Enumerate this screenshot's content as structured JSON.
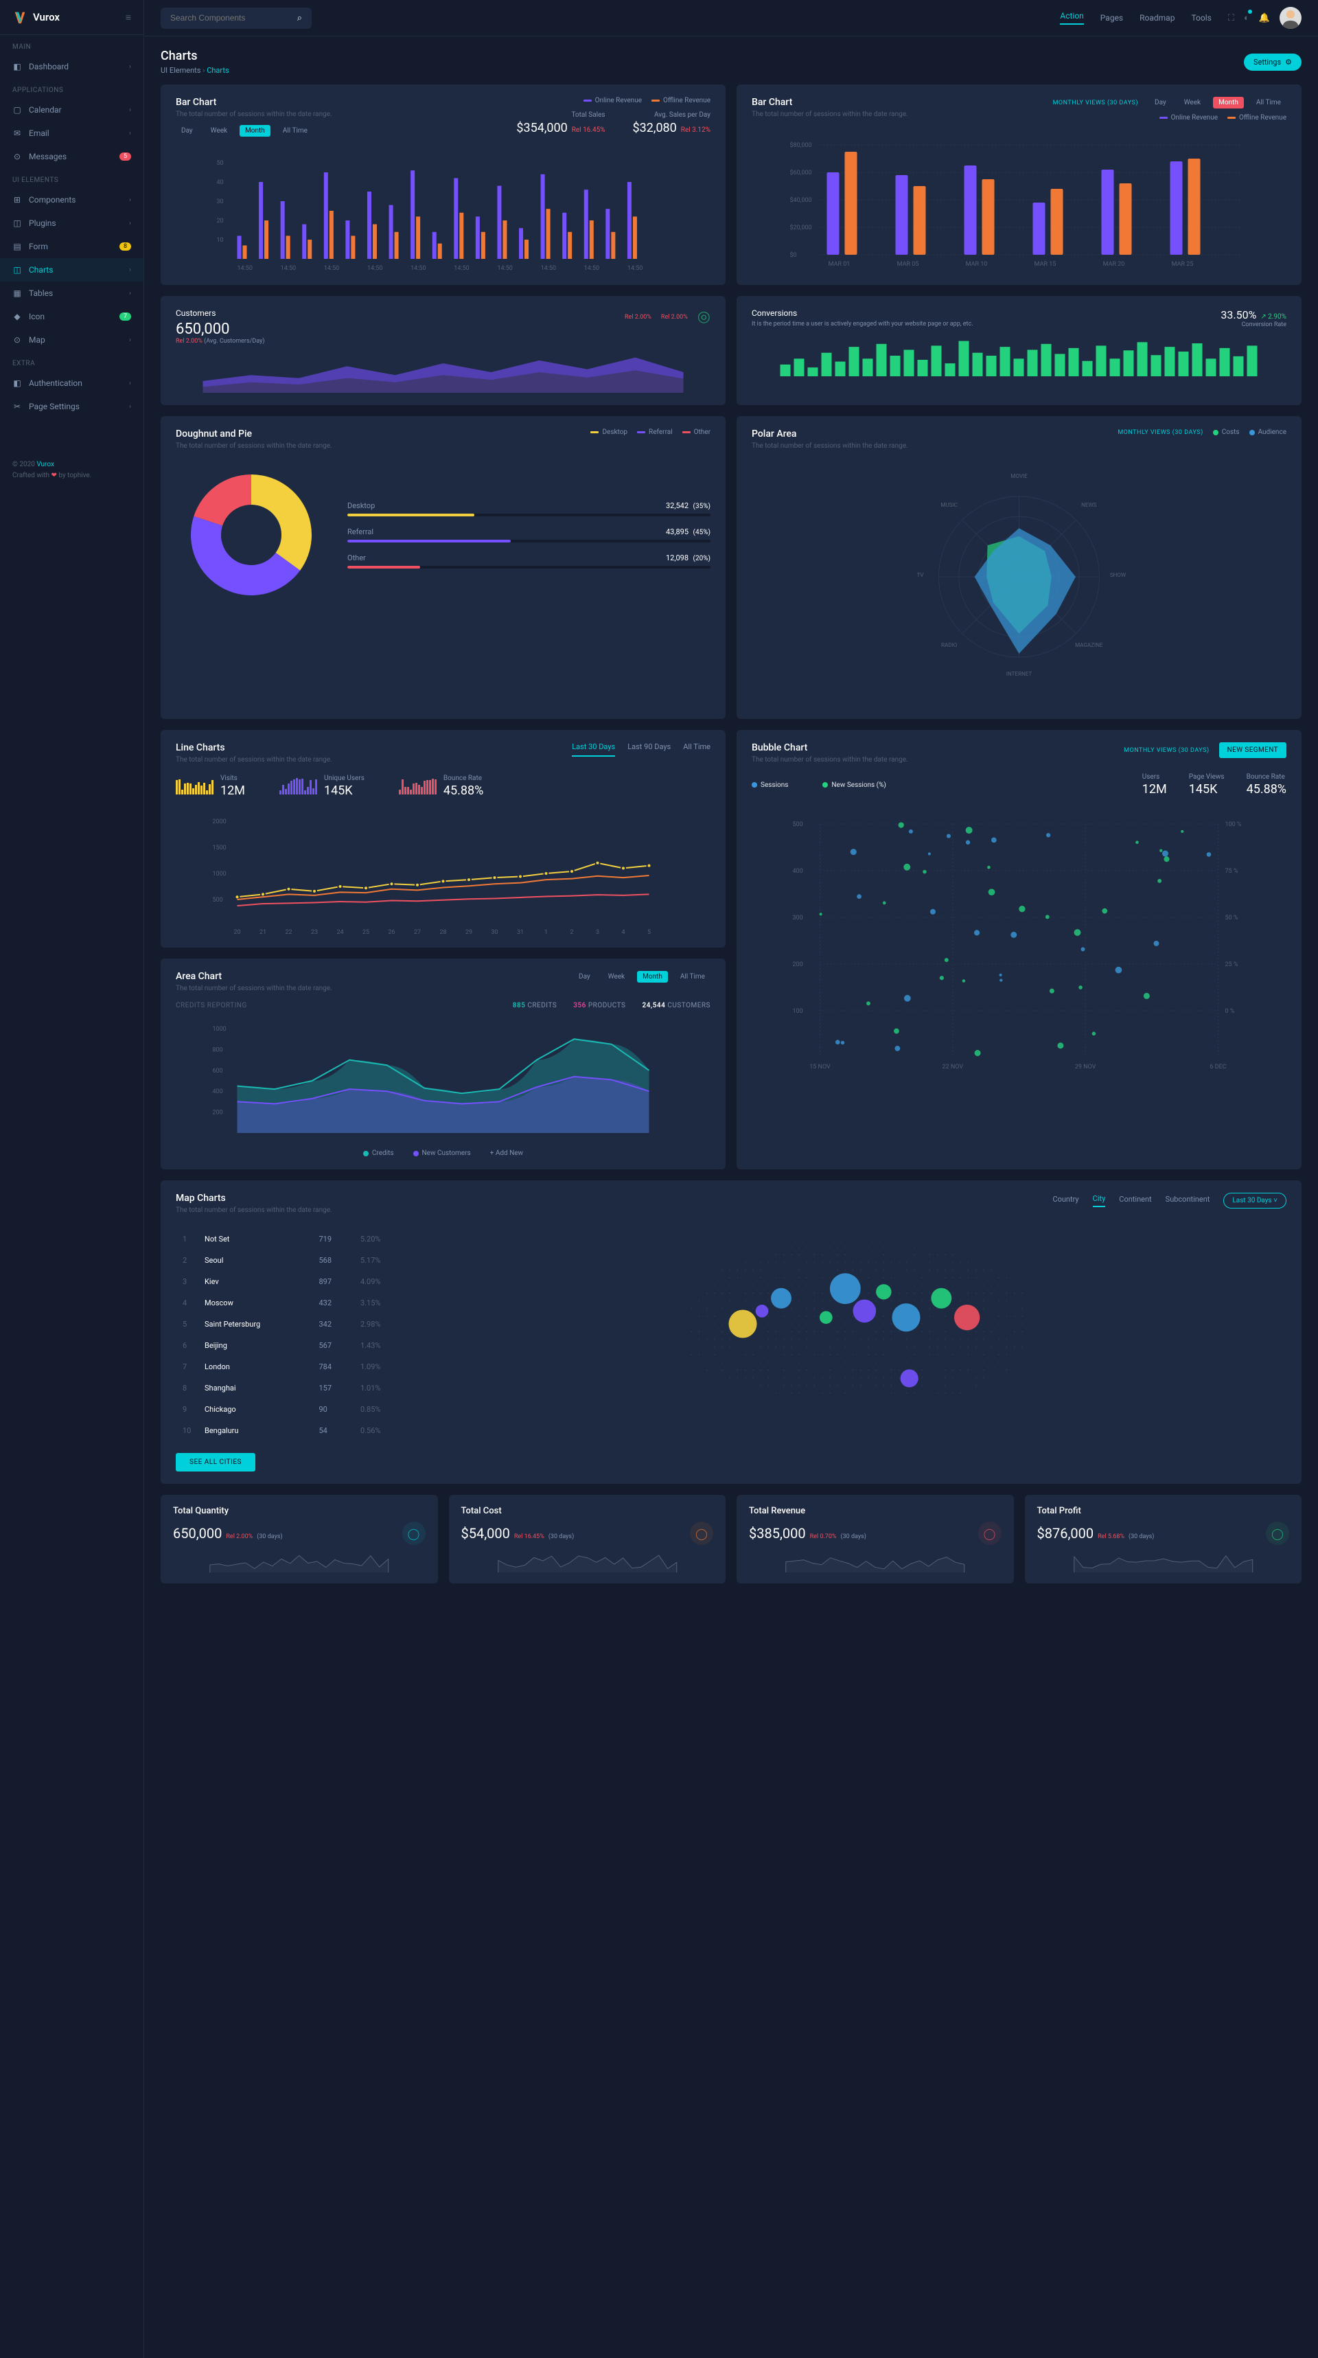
{
  "brand": "Vurox",
  "search": {
    "placeholder": "Search Components"
  },
  "top_nav": [
    "Action",
    "Pages",
    "Roadmap",
    "Tools"
  ],
  "sidebar": {
    "sections": [
      {
        "label": "Main",
        "items": [
          {
            "label": "Dashboard",
            "icon": "◧"
          }
        ]
      },
      {
        "label": "Applications",
        "items": [
          {
            "label": "Calendar",
            "icon": "▢"
          },
          {
            "label": "Email",
            "icon": "✉"
          },
          {
            "label": "Messages",
            "icon": "⊙",
            "badge": "5",
            "badgeClass": "badge-red"
          }
        ]
      },
      {
        "label": "Ui elements",
        "items": [
          {
            "label": "Components",
            "icon": "⊞"
          },
          {
            "label": "Plugins",
            "icon": "◫"
          },
          {
            "label": "Form",
            "icon": "▤",
            "badge": "8",
            "badgeClass": "badge-yellow"
          },
          {
            "label": "Charts",
            "icon": "◫",
            "active": true
          },
          {
            "label": "Tables",
            "icon": "▦"
          },
          {
            "label": "Icon",
            "icon": "◆",
            "badge": "7",
            "badgeClass": "badge-green"
          },
          {
            "label": "Map",
            "icon": "⊙"
          }
        ]
      },
      {
        "label": "Extra",
        "items": [
          {
            "label": "Authentication",
            "icon": "◧"
          },
          {
            "label": "Page Settings",
            "icon": "✂"
          }
        ]
      }
    ],
    "footer": {
      "copyright": "© 2020 Vurox",
      "crafted": "Crafted with ❤ by tophive."
    }
  },
  "page": {
    "title": "Charts",
    "breadcrumb": [
      "UI Elements",
      "Charts"
    ],
    "settings_btn": "Settings"
  },
  "bar1": {
    "title": "Bar Chart",
    "subtitle": "The total number of sessions within the date range.",
    "range": [
      "Day",
      "Week",
      "Month",
      "All Time"
    ],
    "legend": [
      "Online Revenue",
      "Offline Revenue"
    ],
    "stats": {
      "total_sales": {
        "label": "Total Sales",
        "value": "$354,000",
        "change": "Rel 16.45%"
      },
      "avg_sales": {
        "label": "Avg. Sales per Day",
        "value": "$32,080",
        "change": "Rel 3.12%"
      }
    }
  },
  "bar2": {
    "title": "Bar Chart",
    "subtitle": "The total number of sessions within the date range.",
    "monthly_views": "Monthly Views (30 Days)",
    "range": [
      "Day",
      "Week",
      "Month",
      "All Time"
    ],
    "legend": [
      "Online Revenue",
      "Offline Revenue"
    ]
  },
  "customers": {
    "title": "Customers",
    "value": "650,000",
    "sub_pct": "Rel 2.00%",
    "sub_text": "(Avg. Customers/Day)",
    "top_right": [
      "Rel 2.00%",
      "Rel 2.00%"
    ]
  },
  "conversions": {
    "title": "Conversions",
    "subtitle": "It is the period time a user is actively engaged with your website page or app, etc.",
    "value": "33.50%",
    "change": "2.90%",
    "rate_label": "Conversion Rate"
  },
  "donut": {
    "title": "Doughnut and Pie",
    "subtitle": "The total number of sessions within the date range.",
    "legend": [
      "Desktop",
      "Referral",
      "Other"
    ],
    "items": [
      {
        "label": "Desktop",
        "value": "32,542",
        "pct": "(35%)",
        "w": 35,
        "color": "#f4d03f"
      },
      {
        "label": "Referral",
        "value": "43,895",
        "pct": "(45%)",
        "w": 45,
        "color": "#7450fe"
      },
      {
        "label": "Other",
        "value": "12,098",
        "pct": "(20%)",
        "w": 20,
        "color": "#ef5160"
      }
    ]
  },
  "polar": {
    "title": "Polar Area",
    "subtitle": "The total number of sessions within the date range.",
    "monthly_views": "Monthly Views (30 Days)",
    "legend": [
      "Costs",
      "Audience"
    ],
    "axes": [
      "MOVIE",
      "NEWS",
      "SHOW",
      "MAGAZINE",
      "INTERNET",
      "RADIO",
      "TV",
      "MUSIC"
    ]
  },
  "line": {
    "title": "Line Charts",
    "subtitle": "The total number of sessions within the date range.",
    "tabs": [
      "Last 30 Days",
      "Last 90 Days",
      "All Time"
    ],
    "stats": [
      {
        "label": "Visits",
        "value": "12M",
        "color": "#f4d03f"
      },
      {
        "label": "Unique Users",
        "value": "145K",
        "color": "#7450fe"
      },
      {
        "label": "Bounce Rate",
        "value": "45.88%",
        "color": "#ef5160"
      }
    ]
  },
  "area": {
    "title": "Area Chart",
    "subtitle": "The total number of sessions within the date range.",
    "range": [
      "Day",
      "Week",
      "Month",
      "All Time"
    ],
    "credits_label": "CREDITS REPORTING",
    "credits_nums": [
      {
        "n": "885",
        "l": "CREDITS",
        "c": "#1abab4"
      },
      {
        "n": "356",
        "l": "PRODUCTS",
        "c": "#e84393"
      },
      {
        "n": "24,544",
        "l": "CUSTOMERS",
        "c": "#fff"
      }
    ],
    "legend": [
      "Credits",
      "New Customers",
      "+ Add New"
    ]
  },
  "bubble": {
    "title": "Bubble Chart",
    "subtitle": "The total number of sessions within the date range.",
    "monthly_views": "Monthly Views (30 Days)",
    "btn": "NEW SEGMENT",
    "legend": [
      "Sessions",
      "New Sessions (%)"
    ],
    "stats": [
      {
        "label": "Users",
        "value": "12M"
      },
      {
        "label": "Page Views",
        "value": "145K"
      },
      {
        "label": "Bounce Rate",
        "value": "45.88%"
      }
    ]
  },
  "map": {
    "title": "Map Charts",
    "subtitle": "The total number of sessions within the date range.",
    "tabs": [
      "Country",
      "City",
      "Continent",
      "Subcontinent"
    ],
    "range_btn": "Last 30 Days",
    "see_all": "SEE ALL CITIES",
    "cities": [
      {
        "rank": 1,
        "city": "Not Set",
        "val": "719",
        "pct": "5.20%"
      },
      {
        "rank": 2,
        "city": "Seoul",
        "val": "568",
        "pct": "5.17%"
      },
      {
        "rank": 3,
        "city": "Kiev",
        "val": "897",
        "pct": "4.09%"
      },
      {
        "rank": 4,
        "city": "Moscow",
        "val": "432",
        "pct": "3.15%"
      },
      {
        "rank": 5,
        "city": "Saint Petersburg",
        "val": "342",
        "pct": "2.98%"
      },
      {
        "rank": 6,
        "city": "Beijing",
        "val": "567",
        "pct": "1.43%"
      },
      {
        "rank": 7,
        "city": "London",
        "val": "784",
        "pct": "1.09%"
      },
      {
        "rank": 8,
        "city": "Shanghai",
        "val": "157",
        "pct": "1.01%"
      },
      {
        "rank": 9,
        "city": "Chickago",
        "val": "90",
        "pct": "0.85%"
      },
      {
        "rank": 10,
        "city": "Bengaluru",
        "val": "54",
        "pct": "0.56%"
      }
    ]
  },
  "totals": [
    {
      "title": "Total Quantity",
      "value": "650,000",
      "change": "Rel 2.00%",
      "changeClass": "down",
      "period": "(30 days)",
      "iconClass": "ti-cyan",
      "icon": "◯"
    },
    {
      "title": "Total Cost",
      "value": "$54,000",
      "change": "Rel 16.45%",
      "changeClass": "down",
      "period": "(30 days)",
      "iconClass": "ti-orange",
      "icon": "◯"
    },
    {
      "title": "Total Revenue",
      "value": "$385,000",
      "change": "Rel 0.70%",
      "changeClass": "down",
      "period": "(30 days)",
      "iconClass": "ti-red",
      "icon": "◯"
    },
    {
      "title": "Total Profit",
      "value": "$876,000",
      "change": "Rel 5.68%",
      "changeClass": "down",
      "period": "(30 days)",
      "iconClass": "ti-green",
      "icon": "◯"
    }
  ],
  "chart_data": {
    "bar1": {
      "type": "bar",
      "xlabels": [
        "14:50",
        "14:50",
        "14:50",
        "14:50",
        "14:50",
        "14:50",
        "14:50",
        "14:50",
        "14:50",
        "14:50",
        "14:50",
        "14:50",
        "14:50",
        "14:50",
        "14:50",
        "14:50",
        "14:50",
        "14:50",
        "14:50"
      ],
      "ylim": [
        0,
        50
      ],
      "yticks": [
        10,
        20,
        30,
        40,
        50
      ],
      "series": [
        {
          "name": "Online Revenue",
          "values": [
            12,
            40,
            30,
            18,
            45,
            20,
            35,
            28,
            46,
            14,
            42,
            22,
            38,
            16,
            44,
            24,
            36,
            26,
            40
          ]
        },
        {
          "name": "Offline Revenue",
          "values": [
            7,
            20,
            12,
            10,
            25,
            12,
            18,
            14,
            22,
            8,
            24,
            14,
            20,
            10,
            26,
            14,
            20,
            14,
            22
          ]
        }
      ]
    },
    "bar2": {
      "type": "bar",
      "xlabels": [
        "MAR 01",
        "MAR 05",
        "MAR 10",
        "MAR 15",
        "MAR 20",
        "MAR 25"
      ],
      "ylim": [
        0,
        80000
      ],
      "yticks": [
        0,
        20000,
        40000,
        60000,
        80000
      ],
      "series": [
        {
          "name": "Online Revenue",
          "values": [
            60000,
            58000,
            65000,
            38000,
            62000,
            68000
          ]
        },
        {
          "name": "Offline Revenue",
          "values": [
            75000,
            50000,
            55000,
            48000,
            52000,
            70000
          ]
        }
      ]
    },
    "customers_area": {
      "type": "area",
      "series": [
        {
          "name": "a",
          "values": [
            20,
            30,
            25,
            45,
            30,
            50,
            35,
            55,
            40,
            60,
            35
          ]
        },
        {
          "name": "b",
          "values": [
            10,
            18,
            14,
            25,
            18,
            30,
            22,
            35,
            26,
            38,
            24
          ]
        }
      ]
    },
    "conversions_bars": {
      "type": "bar",
      "values": [
        20,
        30,
        15,
        40,
        25,
        50,
        30,
        55,
        35,
        45,
        28,
        52,
        22,
        60,
        40,
        35,
        50,
        30,
        45,
        55,
        38,
        48,
        26,
        52,
        30,
        44,
        58,
        36,
        50,
        42,
        56,
        30,
        48,
        34,
        52
      ]
    },
    "donut": {
      "type": "pie",
      "slices": [
        {
          "label": "Desktop",
          "value": 35,
          "color": "#f4d03f"
        },
        {
          "label": "Referral",
          "value": 45,
          "color": "#7450fe"
        },
        {
          "label": "Other",
          "value": 20,
          "color": "#ef5160"
        }
      ]
    },
    "polar": {
      "type": "polar",
      "axes": [
        "MOVIE",
        "NEWS",
        "SHOW",
        "MAGAZINE",
        "INTERNET",
        "RADIO",
        "TV",
        "MUSIC"
      ],
      "series": [
        {
          "name": "Costs",
          "color": "#24d17d",
          "values": [
            50,
            45,
            40,
            50,
            70,
            45,
            40,
            55
          ]
        },
        {
          "name": "Audience",
          "color": "#3998db",
          "values": [
            60,
            55,
            70,
            65,
            95,
            50,
            55,
            45
          ]
        }
      ]
    },
    "line": {
      "type": "line",
      "x": [
        20,
        21,
        22,
        23,
        24,
        25,
        26,
        27,
        28,
        29,
        30,
        31,
        1,
        2,
        3,
        4,
        5
      ],
      "ylim": [
        0,
        2000
      ],
      "yticks": [
        500,
        1000,
        1500,
        2000
      ],
      "series": [
        {
          "name": "yellow",
          "color": "#f4d03f",
          "values": [
            550,
            600,
            700,
            660,
            750,
            720,
            800,
            780,
            850,
            880,
            920,
            940,
            1000,
            1040,
            1200,
            1100,
            1150
          ]
        },
        {
          "name": "orange",
          "color": "#f27935",
          "values": [
            500,
            550,
            600,
            580,
            640,
            630,
            700,
            680,
            730,
            760,
            800,
            820,
            880,
            900,
            950,
            920,
            960
          ]
        },
        {
          "name": "red",
          "color": "#ef5160",
          "values": [
            380,
            420,
            430,
            440,
            460,
            450,
            480,
            470,
            490,
            510,
            520,
            540,
            560,
            570,
            590,
            580,
            600
          ]
        }
      ]
    },
    "area": {
      "type": "area",
      "ylim": [
        0,
        1000
      ],
      "yticks": [
        200,
        400,
        600,
        800,
        1000
      ],
      "series": [
        {
          "name": "Credits",
          "color": "#1abab4",
          "values": [
            450,
            420,
            500,
            700,
            650,
            430,
            380,
            420,
            700,
            900,
            850,
            600
          ]
        },
        {
          "name": "New Customers",
          "color": "#7450fe",
          "values": [
            300,
            280,
            330,
            420,
            400,
            310,
            280,
            300,
            440,
            540,
            510,
            400
          ]
        }
      ]
    },
    "bubble": {
      "type": "scatter",
      "xlabels": [
        "15 NOV",
        "22 NOV",
        "29 NOV",
        "6 DEC"
      ],
      "ylim_left": [
        0,
        500
      ],
      "ylim_right": [
        0,
        100
      ],
      "yticks_left": [
        100,
        200,
        300,
        400,
        500
      ],
      "yticks_right": [
        "0 %",
        "25 %",
        "50 %",
        "75 %",
        "100 %"
      ]
    }
  }
}
